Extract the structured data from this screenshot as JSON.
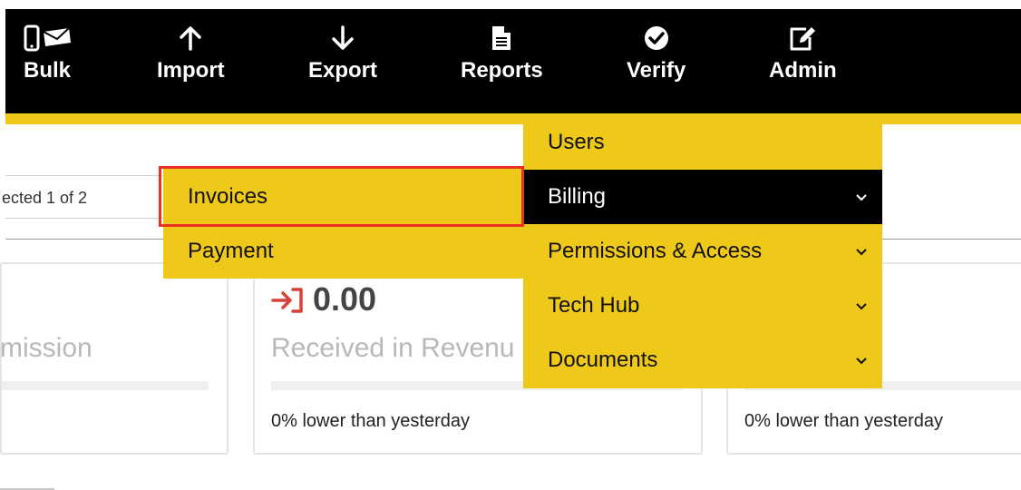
{
  "topbar": {
    "items": [
      {
        "label": "Bulk",
        "icon": "phone-envelope-icon"
      },
      {
        "label": "Import",
        "icon": "arrow-up-icon"
      },
      {
        "label": "Export",
        "icon": "arrow-down-icon"
      },
      {
        "label": "Reports",
        "icon": "document-icon"
      },
      {
        "label": "Verify",
        "icon": "check-circle-icon"
      },
      {
        "label": "Admin",
        "icon": "edit-icon"
      }
    ]
  },
  "selection": {
    "text": "ected 1 of 2"
  },
  "cards": [
    {
      "title": "mission",
      "footer": ""
    },
    {
      "value": "0.00",
      "title": "Received in Revenu",
      "footer": "0% lower than yesterday"
    },
    {
      "footer": "0% lower than yesterday"
    }
  ],
  "admin_menu": {
    "items": [
      {
        "label": "Users"
      },
      {
        "label": "Billing"
      },
      {
        "label": "Permissions & Access"
      },
      {
        "label": "Tech Hub"
      },
      {
        "label": "Documents"
      }
    ]
  },
  "billing_submenu": {
    "items": [
      {
        "label": "Invoices"
      },
      {
        "label": "Payment"
      }
    ]
  },
  "colors": {
    "accent": "#efc919",
    "topbar": "#000000",
    "highlight": "#e8321f",
    "revenue_icon": "#d9413a"
  }
}
